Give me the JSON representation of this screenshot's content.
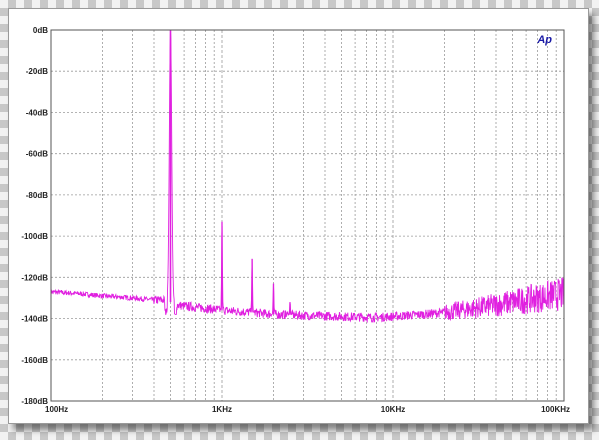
{
  "chart_data": {
    "type": "line",
    "title": "",
    "xlabel": "",
    "ylabel": "",
    "x_scale": "log",
    "xlim": [
      100,
      100000
    ],
    "ylim": [
      -180,
      0
    ],
    "grid": true,
    "x_ticks": [
      100,
      1000,
      10000,
      100000
    ],
    "x_tick_labels": [
      "100Hz",
      "1KHz",
      "10KHz",
      "100KHz"
    ],
    "y_ticks": [
      0,
      -20,
      -40,
      -60,
      -80,
      -100,
      -120,
      -140,
      -160,
      -180
    ],
    "y_tick_labels": [
      "0dB",
      "-20dB",
      "-40dB",
      "-60dB",
      "-80dB",
      "-100dB",
      "-120dB",
      "-140dB",
      "-160dB",
      "-180dB"
    ],
    "series": [
      {
        "color": "#e020e0",
        "noise_floor": {
          "x": [
            100,
            150,
            200,
            300,
            400,
            480,
            520,
            600,
            800,
            1000,
            1500,
            2000,
            3000,
            5000,
            8000,
            10000,
            12000,
            15000,
            20000,
            30000,
            50000,
            70000,
            100000
          ],
          "y": [
            -127,
            -128,
            -129,
            -130,
            -131,
            -131,
            -133,
            -134,
            -135,
            -136,
            -137,
            -138,
            -138.5,
            -139,
            -139.5,
            -139,
            -138.5,
            -138,
            -137,
            -135,
            -132,
            -130,
            -128
          ]
        },
        "peaks": [
          {
            "x": 500,
            "y": 0
          },
          {
            "x": 1000,
            "y": -93
          },
          {
            "x": 1500,
            "y": -111
          },
          {
            "x": 2000,
            "y": -123
          },
          {
            "x": 2500,
            "y": -132
          }
        ]
      }
    ]
  },
  "logo": {
    "text": "Ap",
    "icon": "audio-precision-logo-icon"
  }
}
